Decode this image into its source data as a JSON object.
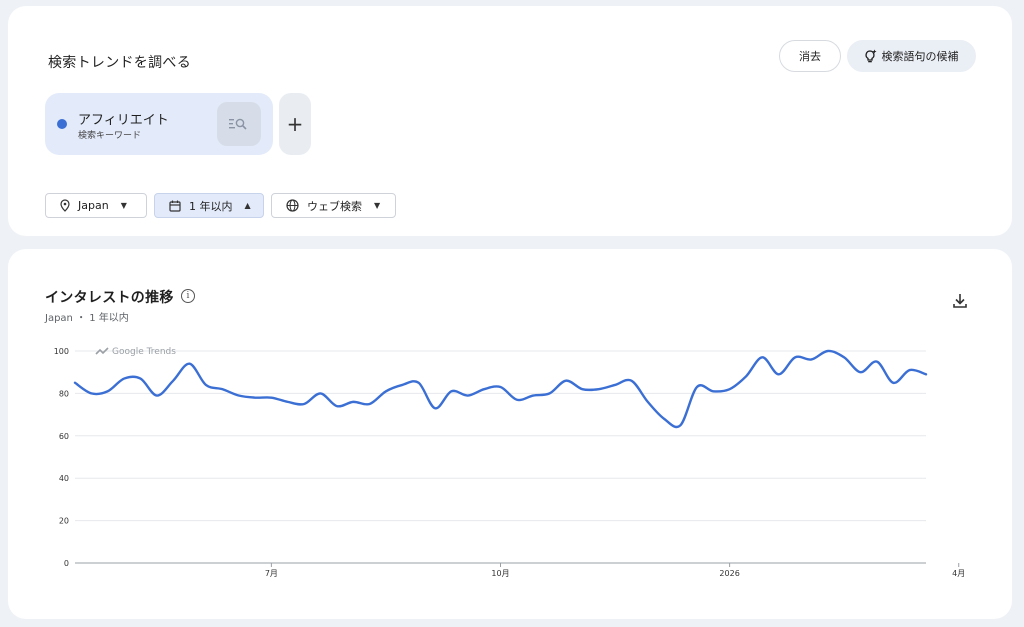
{
  "search_panel": {
    "title": "検索トレンドを調べる",
    "clear_label": "消去",
    "suggest_label": "検索語句の候補",
    "term": {
      "name": "アフィリエイト",
      "type": "検索キーワード",
      "color": "#3b6fd4"
    },
    "add_label": "+",
    "filters": {
      "geo": "Japan",
      "time": "1 年以内",
      "property": "ウェブ検索"
    }
  },
  "chart_panel": {
    "title": "インタレストの推移",
    "subtitle": "Japan ・ 1 年以内",
    "info_glyph": "i",
    "watermark": "Google Trends"
  },
  "chart_data": {
    "type": "line",
    "title": "インタレストの推移",
    "xlabel": "",
    "ylabel": "",
    "ylim": [
      0,
      100
    ],
    "yticks": [
      0,
      20,
      40,
      60,
      80,
      100
    ],
    "xticks": [
      {
        "label": "7月",
        "index": 12
      },
      {
        "label": "10月",
        "index": 26
      },
      {
        "label": "2026",
        "index": 40
      },
      {
        "label": "4月",
        "index": 54
      }
    ],
    "grid": true,
    "series": [
      {
        "color": "#3b6fd4",
        "values": [
          85,
          80,
          81,
          87,
          87,
          79,
          86,
          94,
          84,
          82,
          79,
          78,
          78,
          76,
          75,
          80,
          74,
          76,
          75,
          81,
          84,
          85,
          73,
          81,
          79,
          82,
          83,
          77,
          79,
          80,
          86,
          82,
          82,
          84,
          86,
          76,
          68,
          65,
          83,
          81,
          82,
          88,
          97,
          89,
          97,
          96,
          100,
          97,
          90,
          95,
          85,
          91,
          89
        ]
      }
    ]
  }
}
